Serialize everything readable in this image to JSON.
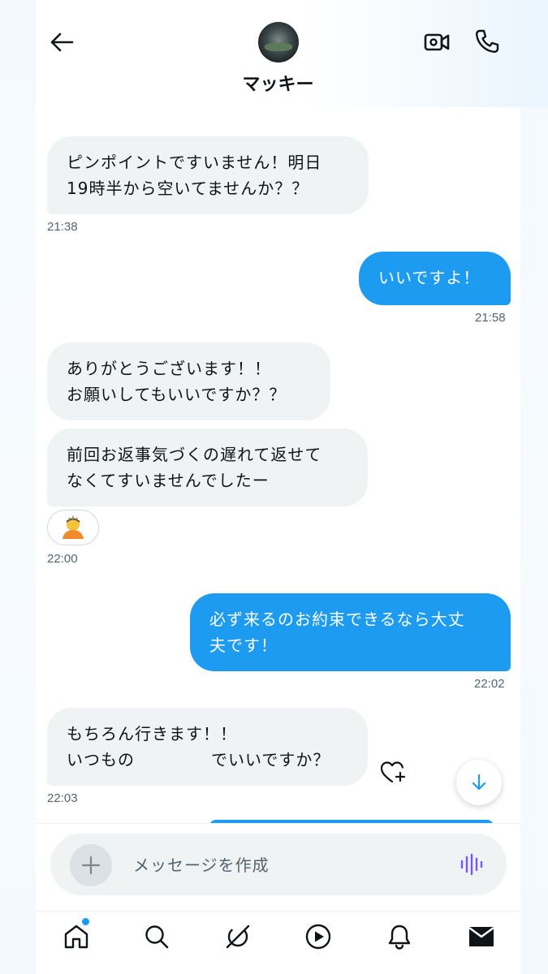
{
  "header": {
    "contact_name": "マッキー",
    "icons": {
      "back": "arrow-left-icon",
      "video": "video-camera-icon",
      "call": "phone-icon"
    }
  },
  "messages": [
    {
      "direction": "in",
      "text": "ピンポイントですいません！明日\n19時半から空いてませんか？？"
    },
    {
      "direction": "out",
      "text": "いいですよ！"
    },
    {
      "direction": "in",
      "text": "ありがとうございます！！\nお願いしてもいいですか？？"
    },
    {
      "direction": "in",
      "text": "前回お返事気づくの遅れて返せて\nなくてすいませんでしたー"
    },
    {
      "direction": "out",
      "text": "必ず来るのお約束できるなら大丈\n夫です！"
    },
    {
      "direction": "in",
      "text_line1": "もちろん行きます！！",
      "text_line2_start": "いつもの",
      "text_line2_end": "でいいですか？"
    }
  ],
  "timestamps": {
    "t1": "21:38",
    "t2": "21:58",
    "t3": "22:00",
    "t4": "22:02",
    "t5": "22:03"
  },
  "reaction": {
    "emoji": "🙇",
    "icon": "bowing-person-emoji"
  },
  "composer": {
    "placeholder": "メッセージを作成",
    "icons": {
      "add": "plus-icon",
      "voice": "voice-waveform-icon"
    }
  },
  "tabbar": {
    "items": [
      "home-icon",
      "search-icon",
      "grok-icon",
      "play-icon",
      "bell-icon",
      "mail-icon"
    ],
    "active": "mail-icon"
  },
  "colors": {
    "accent": "#1d9bf0",
    "incoming_bubble": "#eff3f4",
    "text": "#0f1419",
    "secondary_text": "#536471",
    "voice_icon": "#7856ff"
  }
}
